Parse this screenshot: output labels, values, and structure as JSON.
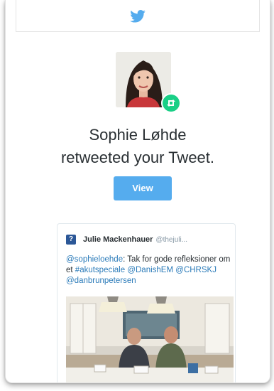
{
  "notification": {
    "user_name": "Sophie Løhde",
    "action_text": "retweeted your Tweet.",
    "view_button": "View"
  },
  "tweet": {
    "author_name": "Julie Mackenhauer",
    "author_handle": "@thejuli...",
    "segments": [
      {
        "text": "@sophieloehde",
        "type": "link"
      },
      {
        "text": ": Tak for gode refleksioner om et ",
        "type": "text"
      },
      {
        "text": "#akutspeciale",
        "type": "link"
      },
      {
        "text": " ",
        "type": "text"
      },
      {
        "text": "@DanishEM",
        "type": "link"
      },
      {
        "text": " ",
        "type": "text"
      },
      {
        "text": "@CHRSKJ",
        "type": "link"
      },
      {
        "text": " ",
        "type": "text"
      },
      {
        "text": "@danbrunpetersen",
        "type": "link"
      }
    ]
  },
  "icons": {
    "header": "twitter-bird-icon",
    "badge": "retweet-icon"
  },
  "colors": {
    "twitter_blue": "#55acee",
    "link_blue": "#2b7bb9",
    "retweet_green": "#19cf86",
    "text_dark": "#292f33",
    "muted": "#8899a6"
  }
}
